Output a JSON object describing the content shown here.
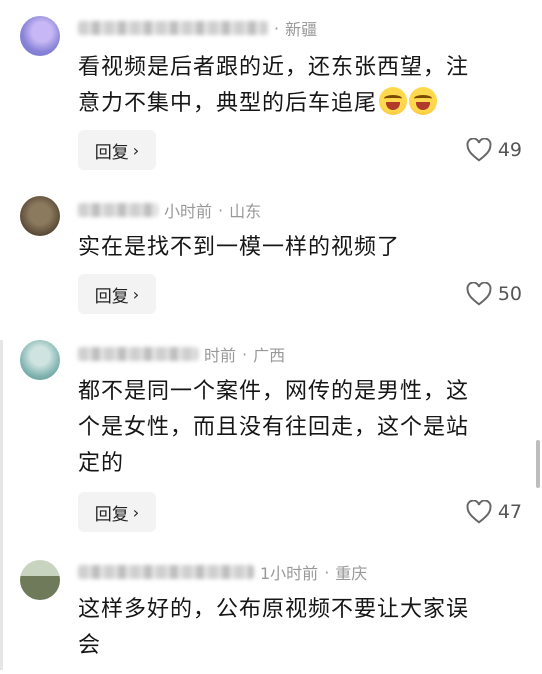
{
  "comments": [
    {
      "location": "新疆",
      "time": "",
      "text_line1": "看视频是后者跟的近，还东张西望，注",
      "text_line2": "意力不集中，典型的后车追尾",
      "emoji_count": 2,
      "reply_label": "回复",
      "likes": "49",
      "avatar_color": "#8a84d8"
    },
    {
      "location": "山东",
      "time": "小时前",
      "text_line1": "实在是找不到一模一样的视频了",
      "reply_label": "回复",
      "likes": "50",
      "avatar_color": "#5a4a38"
    },
    {
      "location": "广西",
      "time": "时前",
      "text_line1": "都不是同一个案件，网传的是男性，这",
      "text_line2": "个是女性，而且没有往回走，这个是站",
      "text_line3": "定的",
      "reply_label": "回复",
      "likes": "47",
      "avatar_color": "#7fb3b0"
    },
    {
      "location": "重庆",
      "time": "1小时前",
      "text_line1": "这样多好的，公布原视频不要让大家误",
      "text_line2": "会",
      "avatar_color": "#6f7a5a"
    }
  ],
  "separator": "·"
}
